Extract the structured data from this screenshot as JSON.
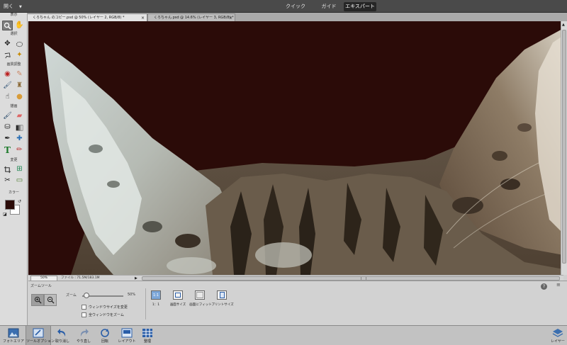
{
  "app": {
    "open_label": "開く"
  },
  "modes": {
    "quick": "クイック",
    "guide": "ガイド",
    "expert": "エキスパート"
  },
  "tabs": [
    {
      "label": "くろちゃん のコピー.psd @ 50% (レイヤー 2, RGB/8) *"
    },
    {
      "label": "くろちゃん.psd @ 14.6% (レイヤー 3, RGB/8) *"
    }
  ],
  "tools": {
    "sections": {
      "view": "表示",
      "select": "選択",
      "enhance": "画質調整",
      "draw": "描画",
      "modify": "変更",
      "color": "カラー"
    }
  },
  "status": {
    "zoom": "50%",
    "file": "ファイル : 71.5M/183.1M"
  },
  "options": {
    "title": "ズームツール",
    "zoom_label": "ズーム",
    "zoom_value": "50%",
    "zoom_fraction": 0.1,
    "resize_windows": "ウィンドウサイズを変更",
    "zoom_all": "全ウィンドウをズーム",
    "buttons": [
      {
        "icon": "1:1",
        "label": "1：1"
      },
      {
        "icon": "",
        "label": "画面サイズ"
      },
      {
        "icon": "",
        "label": "画面にフィット"
      },
      {
        "icon": "",
        "label": "プリントサイズ"
      }
    ]
  },
  "dock": {
    "photo_bin": "フォトエリア",
    "tool_options": "ツールオプション",
    "undo": "取り消し",
    "redo": "やり直し",
    "rotate": "回転",
    "layout": "レイアウト",
    "organizer": "整理",
    "layers": "レイヤー"
  },
  "colors": {
    "canvas_bg": "#2b0b08",
    "foreground": "#2b0b08",
    "background": "#ffffff"
  }
}
